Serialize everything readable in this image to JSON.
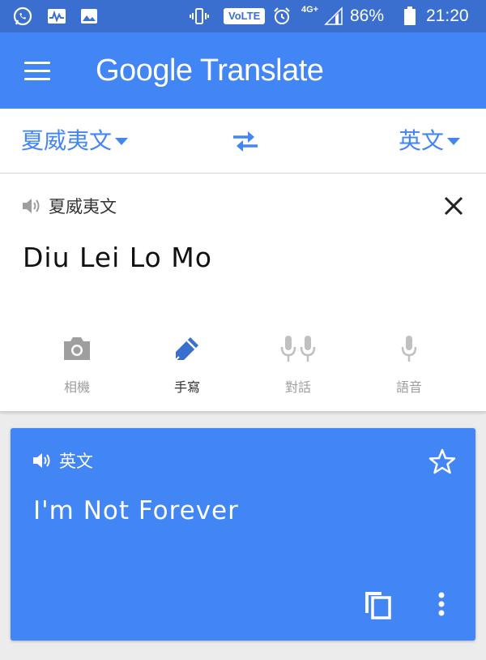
{
  "status_bar": {
    "battery_percent": "86%",
    "time": "21:20",
    "volte_label": "VoLTE",
    "network_label": "4G+",
    "icons": [
      "whatsapp-icon",
      "activity-icon",
      "image-icon",
      "vibrate-icon",
      "alarm-icon",
      "signal-icon",
      "battery-icon"
    ]
  },
  "app_bar": {
    "title": "Google Translate",
    "menu_icon": "menu-icon"
  },
  "languages": {
    "source": "夏威夷文",
    "target": "英文",
    "swap_icon": "swap-icon"
  },
  "input": {
    "language_label": "夏威夷文",
    "text": "Diu Lei Lo Mo",
    "tools": [
      {
        "label": "相機",
        "icon": "camera-icon",
        "active": false
      },
      {
        "label": "手寫",
        "icon": "pen-icon",
        "active": true
      },
      {
        "label": "對話",
        "icon": "dual-mic-icon",
        "active": false
      },
      {
        "label": "語音",
        "icon": "mic-icon",
        "active": false
      }
    ]
  },
  "result": {
    "language_label": "英文",
    "text": "I'm Not Forever",
    "icons": [
      "speaker-icon",
      "star-icon",
      "copy-icon",
      "more-icon"
    ]
  },
  "colors": {
    "status_bar": "#3a6fd0",
    "accent": "#4285f4",
    "inactive_tool": "#9e9e9e",
    "background": "#ececec"
  }
}
